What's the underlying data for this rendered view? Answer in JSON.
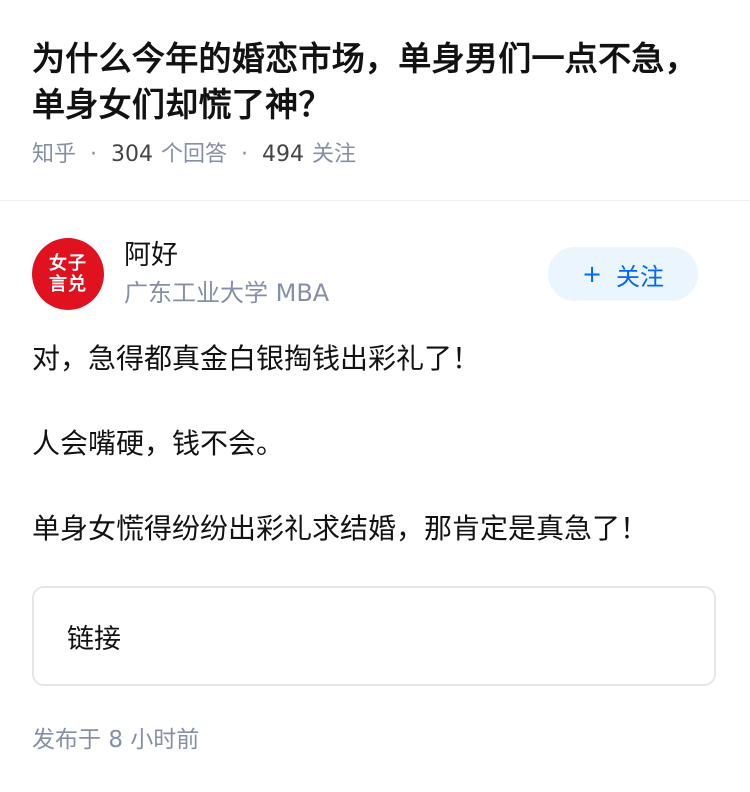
{
  "question": {
    "title": "为什么今年的婚恋市场，单身男们一点不急，单身女们却慌了神？",
    "source": "知乎",
    "answer_count": "304",
    "answer_label": "个回答",
    "follower_count": "494",
    "follower_label": "关注"
  },
  "author": {
    "avatar_text_line1": "女子",
    "avatar_text_line2": "言兑",
    "name": "阿好",
    "bio": "广东工业大学 MBA",
    "follow_label": "关注"
  },
  "answer": {
    "paragraphs": [
      "对，急得都真金白银掏钱出彩礼了！",
      "人会嘴硬，钱不会。",
      "单身女慌得纷纷出彩礼求结婚，那肯定是真急了！"
    ],
    "link_card_label": "链接",
    "publish_prefix": "发布于",
    "publish_time": "8 小时前"
  },
  "colors": {
    "accent": "#0066ff",
    "follow_bg": "#ebf5fd",
    "meta_gray": "#8590a6",
    "avatar_red": "#e0121f"
  }
}
